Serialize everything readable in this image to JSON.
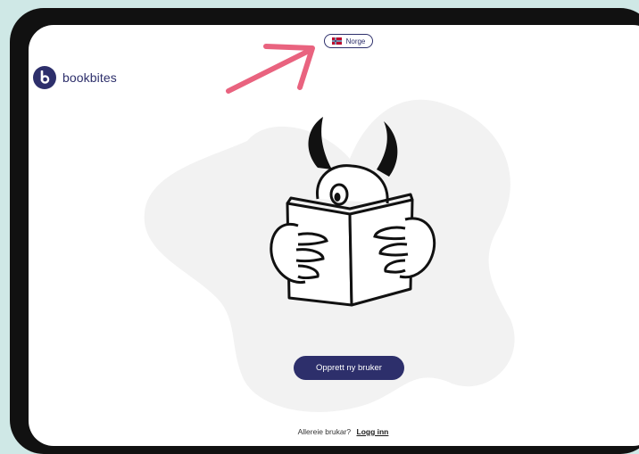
{
  "brand": {
    "name": "bookbites",
    "logo_icon": "bookbites-b-logo-icon",
    "color": "#2d2f6b"
  },
  "country_selector": {
    "label": "Norge",
    "flag_icon": "norway-flag-icon"
  },
  "annotation": {
    "arrow_icon": "pink-arrow-icon",
    "color": "#e9637f"
  },
  "hero": {
    "illustration_icon": "horned-monster-reading-book-icon",
    "blob_color": "#f2f2f2"
  },
  "actions": {
    "create_account_label": "Opprett ny bruker",
    "already_user_text": "Allereie brukar?",
    "login_label": "Logg inn"
  }
}
